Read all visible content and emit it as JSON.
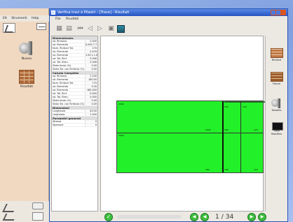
{
  "left_app": {
    "menu": [
      "Elt",
      "Strumenti",
      "Help"
    ],
    "icons": [
      {
        "name": "nuovo",
        "label": "Nuovo",
        "icon": "disc-saw-icon"
      },
      {
        "name": "risultati",
        "label": "Risultati",
        "icon": "brick-wall-icon"
      }
    ]
  },
  "window": {
    "title": "Verifica travi e Pilastri - [Trave] - Risultati",
    "menu": [
      "File",
      "Risultati"
    ]
  },
  "data_panel": {
    "sections": [
      {
        "header": "Dimensionam.",
        "rows": [
          {
            "label": "sd. Rinforzo",
            "value": "2.000"
          },
          {
            "label": "sd. Elemento",
            "value": "0.000 7.7"
          },
          {
            "label": "Num. Rinforzi Tot.",
            "value": "170"
          },
          {
            "label": "sd. Elemento",
            "value": "0.476"
          },
          {
            "label": "sd. Elemento",
            "value": "1.00 x 1.00"
          },
          {
            "label": "sd. Tot. Rinf.",
            "value": "0.006"
          },
          {
            "label": "sd. Tot. Elem.",
            "value": "0.006"
          },
          {
            "label": "Stato tenso (%)",
            "value": "0.00"
          },
          {
            "label": "Stato Tot. con Rinforzo (%)",
            "value": "0.00"
          }
        ]
      },
      {
        "header": "Calcolo Completo",
        "rows": [
          {
            "label": "sd. Rinforzo",
            "value": "1.100"
          },
          {
            "label": "sd. Elemento",
            "value": "180.00"
          },
          {
            "label": "Num. Rinforzi Tot.",
            "value": "170"
          },
          {
            "label": "sd. Elemento",
            "value": "0.50"
          },
          {
            "label": "sd. Elemento",
            "value": "180.000"
          },
          {
            "label": "sd. Tot. Rinf.",
            "value": "0.000"
          },
          {
            "label": "sd. Tot. Elem.",
            "value": "0.000"
          },
          {
            "label": "Stato tenso (%)",
            "value": "0.00"
          },
          {
            "label": "Stato Tot. con Rinforzo (%)",
            "value": "0.00"
          }
        ]
      },
      {
        "header": "Dimensioni",
        "rows": [
          {
            "label": "Lunghezza",
            "value": "40.00"
          },
          {
            "label": "Larghezza",
            "value": "1.000"
          }
        ]
      },
      {
        "header": "Parametri generali",
        "rows": [
          {
            "label": "Altezza",
            "value": "0"
          },
          {
            "label": "Spessore",
            "value": "0"
          }
        ]
      }
    ]
  },
  "canvas": {
    "markers": [
      "2000",
      "220",
      "220",
      "2000",
      "2000",
      "180",
      "220",
      "180",
      "180",
      "220"
    ]
  },
  "right_panel": {
    "items": [
      {
        "label": "Rinforzi",
        "icon": "brick-wall-icon"
      },
      {
        "label": "Fascia",
        "icon": "brick-wall-dark-icon"
      },
      {
        "label": "Tassello",
        "icon": "disc-saw-icon"
      },
      {
        "label": "Modifica",
        "icon": "monitor-icon"
      }
    ]
  },
  "nav": {
    "current_page": "1",
    "separator": "/",
    "total_pages": "34",
    "ok_glyph": "✓",
    "prev_glyph": "◀",
    "prev2_glyph": "◀",
    "next_glyph": "▶",
    "next2_glyph": "▶"
  },
  "colors": {
    "beam_fill": "#22f028",
    "accent_green": "#3fbf3f",
    "titlebar_blue": "#2553c2",
    "left_panel_bg": "#f1d9c1"
  }
}
